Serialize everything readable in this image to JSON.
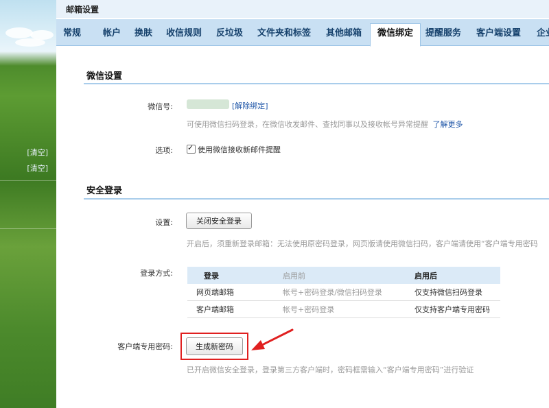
{
  "sidebar": {
    "clear_1": "[清空]",
    "clear_2": "[清空]"
  },
  "panel": {
    "title": "邮箱设置"
  },
  "tabs": [
    {
      "label": "常规",
      "active": false
    },
    {
      "label": "帐户",
      "active": false
    },
    {
      "label": "换肤",
      "active": false
    },
    {
      "label": "收信规则",
      "active": false
    },
    {
      "label": "反垃圾",
      "active": false
    },
    {
      "label": "文件夹和标签",
      "active": false
    },
    {
      "label": "其他邮箱",
      "active": false
    },
    {
      "label": "微信绑定",
      "active": true
    },
    {
      "label": "提醒服务",
      "active": false
    },
    {
      "label": "客户端设置",
      "active": false
    },
    {
      "label": "企业",
      "active": false
    }
  ],
  "wechat": {
    "section_title": "微信设置",
    "id_label": "微信号:",
    "unbind_link": "[解除绑定]",
    "hint": "可使用微信扫码登录，在微信收发邮件、查找同事以及接收帐号异常提醒",
    "learn_more": "了解更多",
    "options_label": "选项:",
    "option_text": "使用微信接收新邮件提醒",
    "option_checked": true
  },
  "security": {
    "section_title": "安全登录",
    "setting_label": "设置:",
    "disable_button": "关闭安全登录",
    "setting_hint": "开启后，须重新登录邮箱：无法使用原密码登录，网页版请使用微信扫码，客户端请使用“客户端专用密码",
    "method_label": "登录方式:",
    "table": {
      "headers": [
        "登录",
        "启用前",
        "启用后"
      ],
      "rows": [
        [
          "网页端邮箱",
          "帐号+密码登录/微信扫码登录",
          "仅支持微信扫码登录"
        ],
        [
          "客户端邮箱",
          "帐号+密码登录",
          "仅支持客户端专用密码"
        ]
      ]
    },
    "client_pwd_label": "客户端专用密码:",
    "generate_button": "生成新密码",
    "client_pwd_hint": "已开启微信安全登录，登录第三方客户端时，密码框需输入“客户端专用密码”进行验证"
  },
  "colors": {
    "accent": "#1f56a8",
    "tab_bar": "#c9e0f3",
    "highlight": "#e02020"
  }
}
